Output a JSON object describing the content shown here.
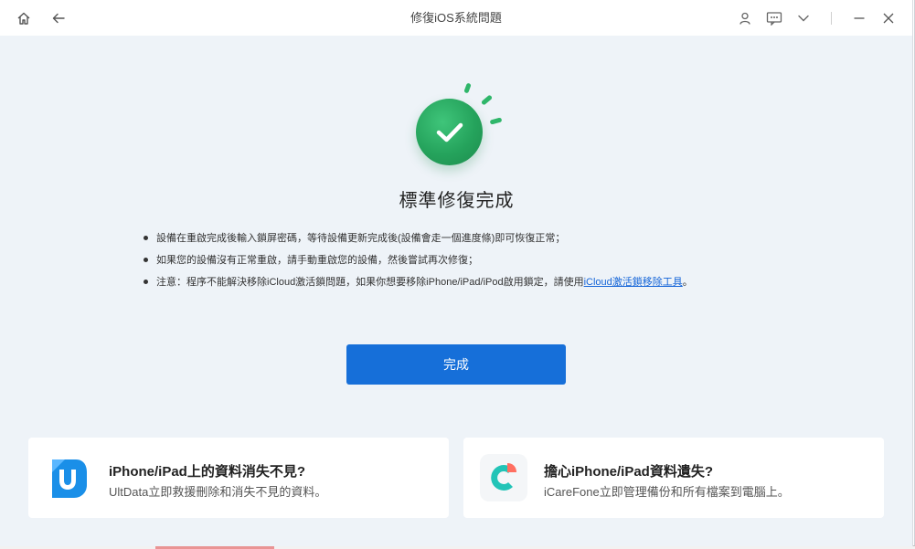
{
  "window": {
    "title": "修復iOS系統問題"
  },
  "titlebar": {
    "left_icons": [
      "home-icon",
      "back-arrow-icon"
    ],
    "right_icons": [
      "user-icon",
      "feedback-icon",
      "chevron-down-icon",
      "minimize-icon",
      "close-icon"
    ]
  },
  "status": {
    "heading": "標準修復完成",
    "icon": "check-circle-icon",
    "color": "#25a35c"
  },
  "notes": [
    {
      "text": "設備在重啟完成後輸入鎖屏密碼，等待設備更新完成後(設備會走一個進度條)即可恢復正常；"
    },
    {
      "text": "如果您的設備沒有正常重啟，請手動重啟您的設備，然後嘗試再次修復；"
    },
    {
      "text": "注意：程序不能解決移除iCloud激活鎖問題，如果你想要移除iPhone/iPad/iPod啟用鎖定，請使用",
      "link": "iCloud激活鎖移除工具",
      "suffix": "。"
    }
  ],
  "actions": {
    "done_label": "完成",
    "accent": "#166fd9"
  },
  "promo_cards": [
    {
      "title": "iPhone/iPad上的資料消失不見?",
      "subtitle": "UltData立即救援刪除和消失不見的資料。",
      "logo": "ultdata-logo-icon"
    },
    {
      "title": "擔心iPhone/iPad資料遺失?",
      "subtitle": "iCareFone立即管理備份和所有檔案到電腦上。",
      "logo": "icarefone-logo-icon"
    }
  ]
}
